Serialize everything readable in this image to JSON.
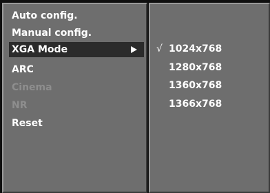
{
  "main_menu": {
    "items": [
      {
        "label": "Auto config.",
        "state": "enabled"
      },
      {
        "label": "Manual config.",
        "state": "enabled"
      },
      {
        "label": "XGA Mode",
        "state": "selected",
        "icon": "arrow-right-icon"
      },
      {
        "label": "ARC",
        "state": "enabled"
      },
      {
        "label": "Cinema",
        "state": "disabled"
      },
      {
        "label": "NR",
        "state": "disabled"
      },
      {
        "label": "Reset",
        "state": "enabled"
      }
    ]
  },
  "xga_submenu": {
    "check_mark": "√",
    "options": [
      {
        "label": "1024x768",
        "checked": true
      },
      {
        "label": "1280x768",
        "checked": false
      },
      {
        "label": "1360x768",
        "checked": false
      },
      {
        "label": "1366x768",
        "checked": false
      }
    ]
  },
  "colors": {
    "panel": "#6e6e6e",
    "highlight": "#2b2b2b",
    "text": "#ffffff",
    "disabled_text": "#8e8e8e",
    "background": "#0f0f0f"
  }
}
